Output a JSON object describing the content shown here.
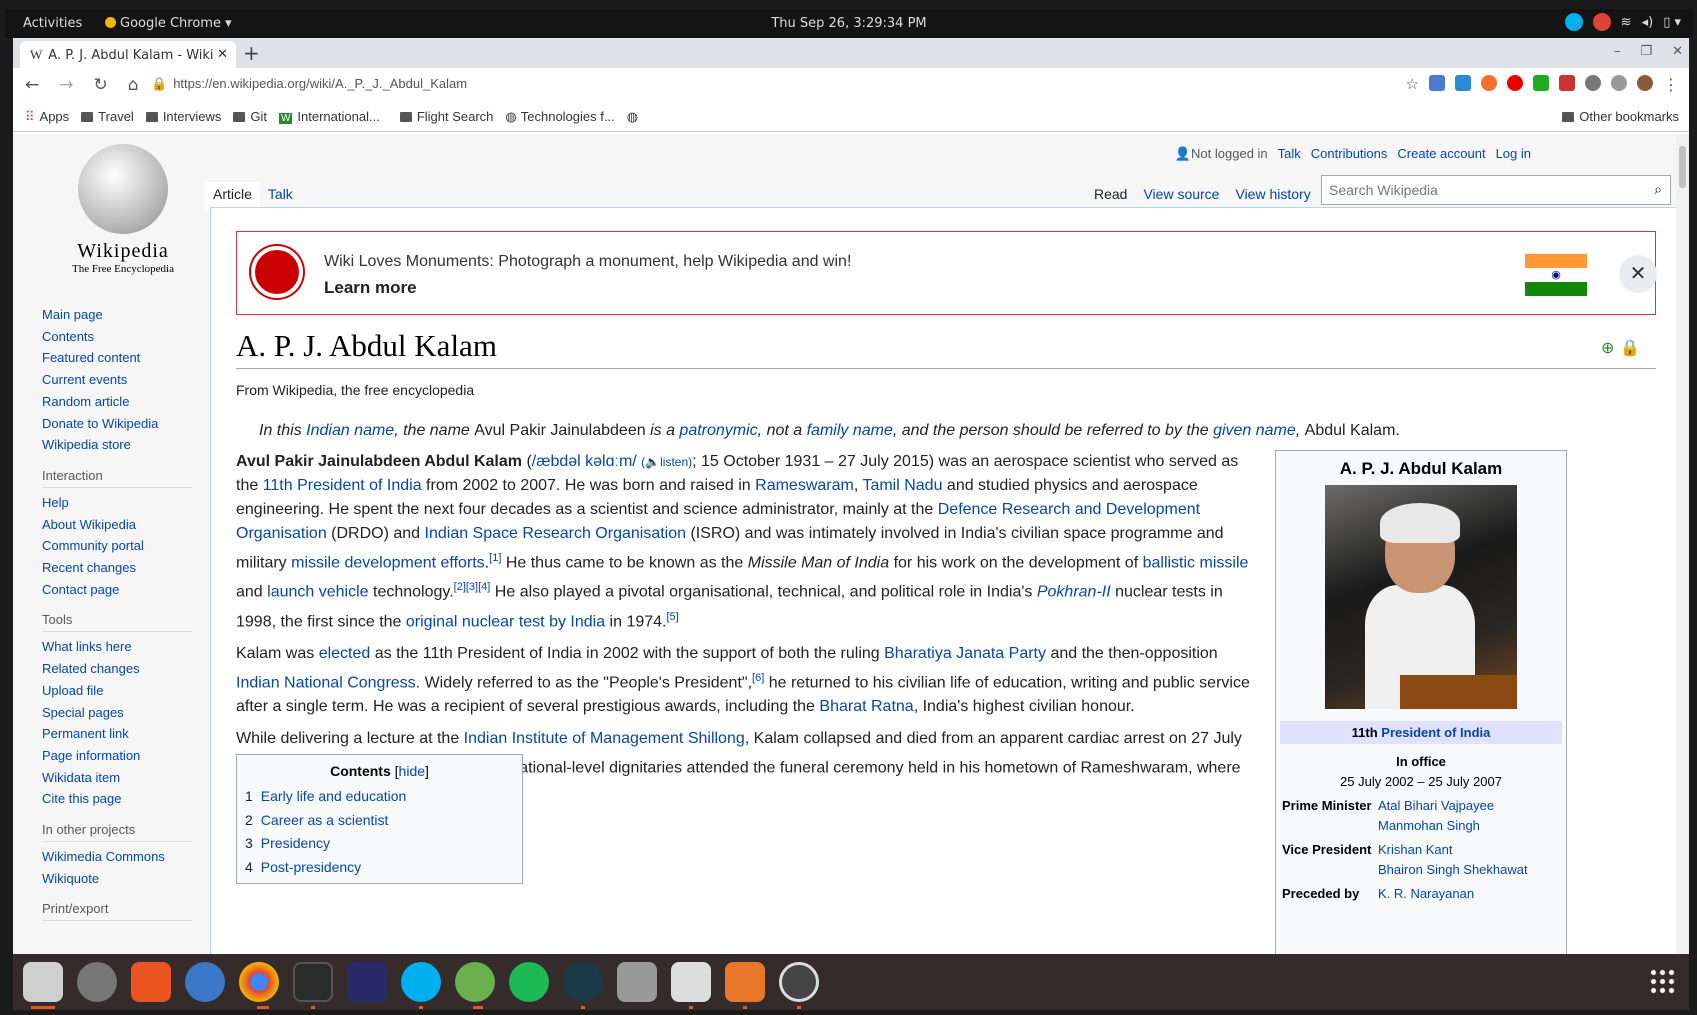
{
  "system": {
    "activities": "Activities",
    "app_name": "Google Chrome ▾",
    "clock": "Thu Sep 26,  3:29:34 PM"
  },
  "browser": {
    "tab_title": "A. P. J. Abdul Kalam - Wiki",
    "tab_favicon": "W",
    "url": "https://en.wikipedia.org/wiki/A._P._J._Abdul_Kalam",
    "bookmarks": [
      "Apps",
      "Travel",
      "Interviews",
      "Git",
      "International...",
      "Flight Search",
      "Technologies f..."
    ],
    "other_bookmarks": "Other bookmarks"
  },
  "wiki": {
    "wordmark": "Wikipedia",
    "tagline": "The Free Encyclopedia",
    "nav": [
      "Main page",
      "Contents",
      "Featured content",
      "Current events",
      "Random article",
      "Donate to Wikipedia",
      "Wikipedia store"
    ],
    "interaction_heading": "Interaction",
    "interaction": [
      "Help",
      "About Wikipedia",
      "Community portal",
      "Recent changes",
      "Contact page"
    ],
    "tools_heading": "Tools",
    "tools": [
      "What links here",
      "Related changes",
      "Upload file",
      "Special pages",
      "Permanent link",
      "Page information",
      "Wikidata item",
      "Cite this page"
    ],
    "projects_heading": "In other projects",
    "projects": [
      "Wikimedia Commons",
      "Wikiquote"
    ],
    "print_heading": "Print/export",
    "personal": {
      "not_logged": "Not logged in",
      "talk": "Talk",
      "contributions": "Contributions",
      "create": "Create account",
      "login": "Log in"
    },
    "tabs": {
      "article": "Article",
      "talk": "Talk",
      "read": "Read",
      "view_source": "View source",
      "view_history": "View history"
    },
    "search_placeholder": "Search Wikipedia",
    "banner": {
      "line1": "Wiki Loves Monuments: Photograph a monument, help Wikipedia and win!",
      "line2": "Learn more"
    },
    "title": "A. P. J. Abdul Kalam",
    "from": "From Wikipedia, the free encyclopedia",
    "toc": {
      "heading": "Contents",
      "hide": "hide",
      "items": [
        {
          "num": "1",
          "label": "Early life and education"
        },
        {
          "num": "2",
          "label": "Career as a scientist"
        },
        {
          "num": "3",
          "label": "Presidency"
        },
        {
          "num": "4",
          "label": "Post-presidency"
        }
      ]
    },
    "infobox": {
      "name": "A. P. J. Abdul Kalam",
      "office_prefix": "11th",
      "office": "President of India",
      "in_office": "In office",
      "dates": "25 July 2002 – 25 July 2007",
      "pm_label": "Prime Minister",
      "pm": [
        "Atal Bihari Vajpayee",
        "Manmohan Singh"
      ],
      "vp_label": "Vice President",
      "vp": [
        "Krishan Kant",
        "Bhairon Singh Shekhawat"
      ],
      "preceded_label": "Preceded by",
      "preceded": "K. R. Narayanan"
    }
  },
  "colors": {
    "link": "#0645ad",
    "banner_border": "#dd3333",
    "dock": "#352b2b"
  }
}
